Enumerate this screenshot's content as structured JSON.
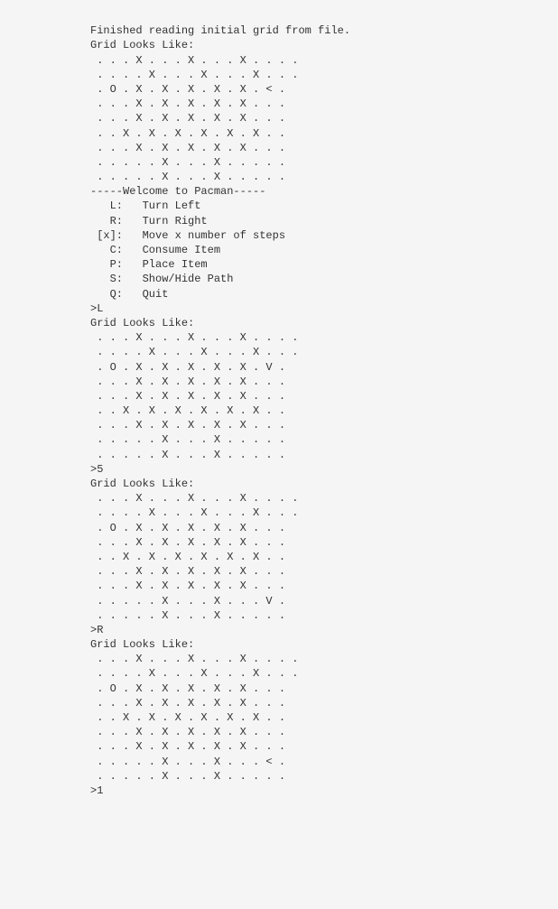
{
  "content": "Finished reading initial grid from file.\nGrid Looks Like:\n . . . X . . . X . . . X . . . .\n . . . . X . . . X . . . X . . .\n . O . X . X . X . X . X . < .\n . . . X . X . X . X . X . . .\n . . . X . X . X . X . X . . .\n . . X . X . X . X . X . X . .\n . . . X . X . X . X . X . . .\n . . . . . X . . . X . . . . .\n . . . . . X . . . X . . . . .\n-----Welcome to Pacman-----\n   L:   Turn Left\n   R:   Turn Right\n [x]:   Move x number of steps\n   C:   Consume Item\n   P:   Place Item\n   S:   Show/Hide Path\n   Q:   Quit\n>L\nGrid Looks Like:\n . . . X . . . X . . . X . . . .\n . . . . X . . . X . . . X . . .\n . O . X . X . X . X . X . V .\n . . . X . X . X . X . X . . .\n . . . X . X . X . X . X . . .\n . . X . X . X . X . X . X . .\n . . . X . X . X . X . X . . .\n . . . . . X . . . X . . . . .\n . . . . . X . . . X . . . . .\n>5\nGrid Looks Like:\n . . . X . . . X . . . X . . . .\n . . . . X . . . X . . . X . . .\n . O . X . X . X . X . X . . .\n . . . X . X . X . X . X . . .\n . . X . X . X . X . X . X . .\n . . . X . X . X . X . X . . .\n . . . X . X . X . X . X . . .\n . . . . . X . . . X . . . V .\n . . . . . X . . . X . . . . .\n>R\nGrid Looks Like:\n . . . X . . . X . . . X . . . .\n . . . . X . . . X . . . X . . .\n . O . X . X . X . X . X . . .\n . . . X . X . X . X . X . . .\n . . X . X . X . X . X . X . .\n . . . X . X . X . X . X . . .\n . . . X . X . X . X . X . . .\n . . . . . X . . . X . . . < .\n . . . . . X . . . X . . . . .\n>1"
}
